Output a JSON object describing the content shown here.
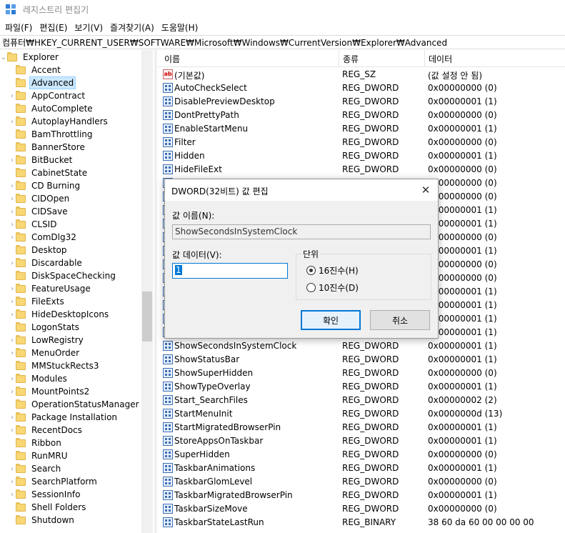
{
  "window": {
    "title": "레지스트리 편집기"
  },
  "menubar": {
    "items": [
      "파일(F)",
      "편집(E)",
      "보기(V)",
      "즐겨찾기(A)",
      "도움말(H)"
    ]
  },
  "address": {
    "path": "컴퓨터₩HKEY_CURRENT_USER₩SOFTWARE₩Microsoft₩Windows₩CurrentVersion₩Explorer₩Advanced"
  },
  "tree": {
    "root": "Explorer",
    "items": [
      {
        "label": "Accent",
        "expandable": false
      },
      {
        "label": "Advanced",
        "expandable": false,
        "selected": true
      },
      {
        "label": "AppContract",
        "expandable": true
      },
      {
        "label": "AutoComplete",
        "expandable": false
      },
      {
        "label": "AutoplayHandlers",
        "expandable": true
      },
      {
        "label": "BamThrottling",
        "expandable": false
      },
      {
        "label": "BannerStore",
        "expandable": false
      },
      {
        "label": "BitBucket",
        "expandable": true
      },
      {
        "label": "CabinetState",
        "expandable": false
      },
      {
        "label": "CD Burning",
        "expandable": true
      },
      {
        "label": "CIDOpen",
        "expandable": true
      },
      {
        "label": "CIDSave",
        "expandable": true
      },
      {
        "label": "CLSID",
        "expandable": true
      },
      {
        "label": "ComDlg32",
        "expandable": true
      },
      {
        "label": "Desktop",
        "expandable": false
      },
      {
        "label": "Discardable",
        "expandable": true
      },
      {
        "label": "DiskSpaceChecking",
        "expandable": false
      },
      {
        "label": "FeatureUsage",
        "expandable": true
      },
      {
        "label": "FileExts",
        "expandable": true
      },
      {
        "label": "HideDesktopIcons",
        "expandable": true
      },
      {
        "label": "LogonStats",
        "expandable": false
      },
      {
        "label": "LowRegistry",
        "expandable": true
      },
      {
        "label": "MenuOrder",
        "expandable": true
      },
      {
        "label": "MMStuckRects3",
        "expandable": false
      },
      {
        "label": "Modules",
        "expandable": true
      },
      {
        "label": "MountPoints2",
        "expandable": true
      },
      {
        "label": "OperationStatusManager",
        "expandable": false
      },
      {
        "label": "Package Installation",
        "expandable": true
      },
      {
        "label": "RecentDocs",
        "expandable": true
      },
      {
        "label": "Ribbon",
        "expandable": false
      },
      {
        "label": "RunMRU",
        "expandable": false
      },
      {
        "label": "Search",
        "expandable": true
      },
      {
        "label": "SearchPlatform",
        "expandable": true
      },
      {
        "label": "SessionInfo",
        "expandable": true
      },
      {
        "label": "Shell Folders",
        "expandable": false
      },
      {
        "label": "Shutdown",
        "expandable": false
      }
    ]
  },
  "list": {
    "headers": {
      "name": "이름",
      "type": "종류",
      "data": "데이터"
    },
    "rows": [
      {
        "icon": "string-value-icon",
        "name": "(기본값)",
        "type": "REG_SZ",
        "data": "(값 설정 안 됨)"
      },
      {
        "icon": "binary-value-icon",
        "name": "AutoCheckSelect",
        "type": "REG_DWORD",
        "data": "0x00000000 (0)"
      },
      {
        "icon": "binary-value-icon",
        "name": "DisablePreviewDesktop",
        "type": "REG_DWORD",
        "data": "0x00000001 (1)"
      },
      {
        "icon": "binary-value-icon",
        "name": "DontPrettyPath",
        "type": "REG_DWORD",
        "data": "0x00000000 (0)"
      },
      {
        "icon": "binary-value-icon",
        "name": "EnableStartMenu",
        "type": "REG_DWORD",
        "data": "0x00000001 (1)"
      },
      {
        "icon": "binary-value-icon",
        "name": "Filter",
        "type": "REG_DWORD",
        "data": "0x00000000 (0)"
      },
      {
        "icon": "binary-value-icon",
        "name": "Hidden",
        "type": "REG_DWORD",
        "data": "0x00000001 (1)"
      },
      {
        "icon": "binary-value-icon",
        "name": "HideFileExt",
        "type": "REG_DWORD",
        "data": "0x00000000 (0)"
      },
      {
        "icon": "binary-value-icon",
        "name": "",
        "type": "",
        "data": "0x00000000 (0)"
      },
      {
        "icon": "binary-value-icon",
        "name": "",
        "type": "",
        "data": "0x00000000 (0)"
      },
      {
        "icon": "binary-value-icon",
        "name": "",
        "type": "",
        "data": "0x00000001 (1)"
      },
      {
        "icon": "binary-value-icon",
        "name": "",
        "type": "",
        "data": "0x00000001 (1)"
      },
      {
        "icon": "binary-value-icon",
        "name": "",
        "type": "",
        "data": "0x00000000 (0)"
      },
      {
        "icon": "binary-value-icon",
        "name": "",
        "type": "",
        "data": "0x00000001 (1)"
      },
      {
        "icon": "binary-value-icon",
        "name": "",
        "type": "",
        "data": "0x00000000 (0)"
      },
      {
        "icon": "binary-value-icon",
        "name": "",
        "type": "",
        "data": "0x00000000 (0)"
      },
      {
        "icon": "binary-value-icon",
        "name": "",
        "type": "",
        "data": "0x00000001 (1)"
      },
      {
        "icon": "binary-value-icon",
        "name": "",
        "type": "",
        "data": "0x00000001 (1)"
      },
      {
        "icon": "binary-value-icon",
        "name": "",
        "type": "",
        "data": "0x00000001 (1)"
      },
      {
        "icon": "binary-value-icon",
        "name": "",
        "type": "",
        "data": "0x00000001 (1)"
      },
      {
        "icon": "binary-value-icon",
        "name": "ShowSecondsInSystemClock",
        "type": "REG_DWORD",
        "data": "0x00000001 (1)"
      },
      {
        "icon": "binary-value-icon",
        "name": "ShowStatusBar",
        "type": "REG_DWORD",
        "data": "0x00000001 (1)"
      },
      {
        "icon": "binary-value-icon",
        "name": "ShowSuperHidden",
        "type": "REG_DWORD",
        "data": "0x00000000 (0)"
      },
      {
        "icon": "binary-value-icon",
        "name": "ShowTypeOverlay",
        "type": "REG_DWORD",
        "data": "0x00000001 (1)"
      },
      {
        "icon": "binary-value-icon",
        "name": "Start_SearchFiles",
        "type": "REG_DWORD",
        "data": "0x00000002 (2)"
      },
      {
        "icon": "binary-value-icon",
        "name": "StartMenuInit",
        "type": "REG_DWORD",
        "data": "0x0000000d (13)"
      },
      {
        "icon": "binary-value-icon",
        "name": "StartMigratedBrowserPin",
        "type": "REG_DWORD",
        "data": "0x00000001 (1)"
      },
      {
        "icon": "binary-value-icon",
        "name": "StoreAppsOnTaskbar",
        "type": "REG_DWORD",
        "data": "0x00000001 (1)"
      },
      {
        "icon": "binary-value-icon",
        "name": "SuperHidden",
        "type": "REG_DWORD",
        "data": "0x00000000 (0)"
      },
      {
        "icon": "binary-value-icon",
        "name": "TaskbarAnimations",
        "type": "REG_DWORD",
        "data": "0x00000001 (1)"
      },
      {
        "icon": "binary-value-icon",
        "name": "TaskbarGlomLevel",
        "type": "REG_DWORD",
        "data": "0x00000000 (0)"
      },
      {
        "icon": "binary-value-icon",
        "name": "TaskbarMigratedBrowserPin",
        "type": "REG_DWORD",
        "data": "0x00000001 (1)"
      },
      {
        "icon": "binary-value-icon",
        "name": "TaskbarSizeMove",
        "type": "REG_DWORD",
        "data": "0x00000000 (0)"
      },
      {
        "icon": "binary-value-icon",
        "name": "TaskbarStateLastRun",
        "type": "REG_BINARY",
        "data": "38 60 da 60 00 00 00 00"
      }
    ]
  },
  "dialog": {
    "title": "DWORD(32비트) 값 편집",
    "name_label": "값 이름(N):",
    "name_value": "ShowSecondsInSystemClock",
    "data_label": "값 데이터(V):",
    "data_value": "1",
    "unit_label": "단위",
    "radio_hex": "16진수(H)",
    "radio_dec": "10진수(D)",
    "selected_unit": "hex",
    "ok_label": "확인",
    "cancel_label": "취소"
  }
}
